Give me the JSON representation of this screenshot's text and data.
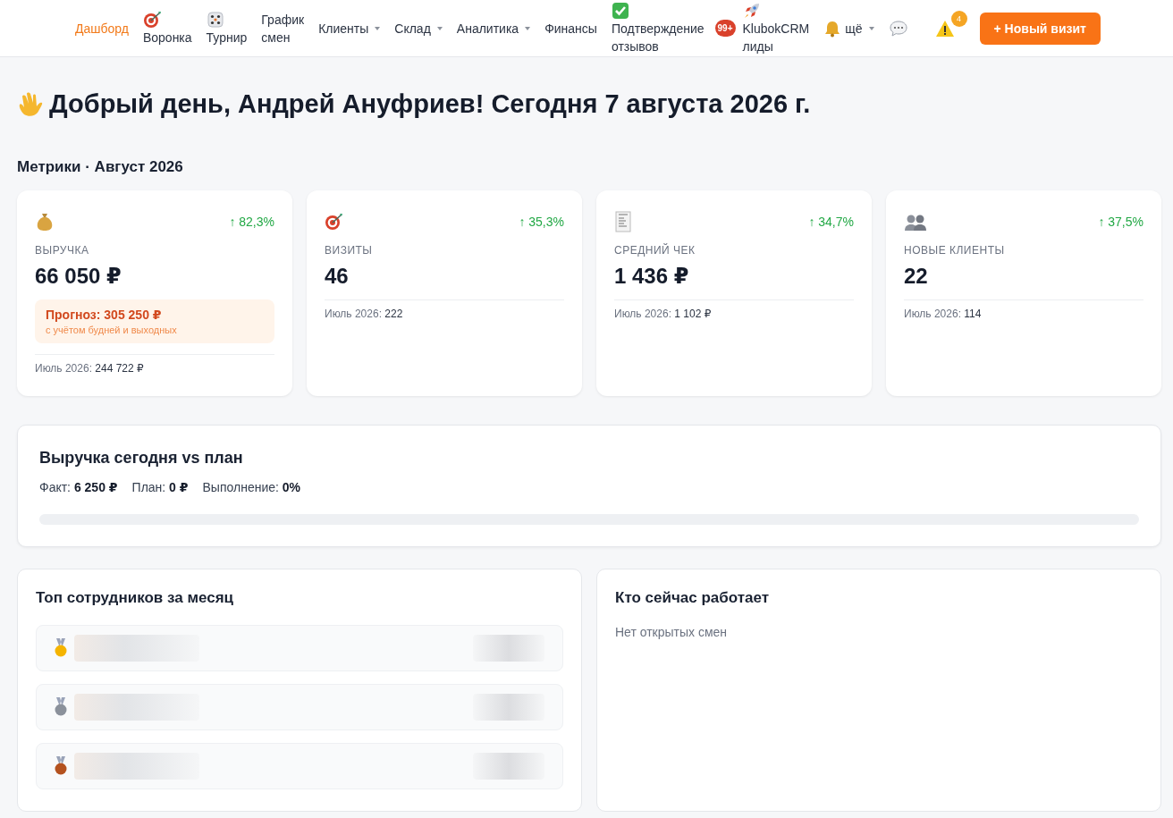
{
  "nav": {
    "items": [
      {
        "label": "Дашборд",
        "kind": "plain",
        "dropdown": false,
        "selected": true
      },
      {
        "label": "Воронка",
        "kind": "target",
        "dropdown": false,
        "selected": false
      },
      {
        "label": "Турнир",
        "kind": "dice",
        "dropdown": false,
        "selected": false
      },
      {
        "label": "График смен",
        "kind": "plain",
        "dropdown": false,
        "selected": false
      },
      {
        "label": "Клиенты",
        "kind": "plain",
        "dropdown": true,
        "selected": false
      },
      {
        "label": "Склад",
        "kind": "plain",
        "dropdown": true,
        "selected": false
      },
      {
        "label": "Аналитика",
        "kind": "plain",
        "dropdown": true,
        "selected": false
      },
      {
        "label": "Финансы",
        "kind": "plain",
        "dropdown": false,
        "selected": false
      },
      {
        "label": "Подтверждение отзывов",
        "kind": "check",
        "dropdown": false,
        "selected": false,
        "badge": "99+"
      },
      {
        "label": "KlubokCRM лиды",
        "kind": "rocket",
        "dropdown": false,
        "selected": false
      },
      {
        "label": "щё",
        "kind": "bell",
        "dropdown": true,
        "selected": false
      }
    ],
    "alerts_badge": "4",
    "new_visit_button": "+ Новый визит"
  },
  "greeting": "Добрый день, Андрей Ануфриев! Сегодня 7 августа 2026 г.",
  "metrics_title": "Метрики · Август 2026",
  "metrics": [
    {
      "kind": "money",
      "change": "↑ 82,3%",
      "label": "ВЫРУЧКА",
      "value": "66 050 ₽",
      "forecast": {
        "title": "Прогноз: 305 250 ₽",
        "note": "с учётом будней и выходных"
      },
      "prev_label": "Июль 2026:",
      "prev_value": "244 722 ₽"
    },
    {
      "kind": "target",
      "change": "↑ 35,3%",
      "label": "ВИЗИТЫ",
      "value": "46",
      "prev_label": "Июль 2026:",
      "prev_value": "222"
    },
    {
      "kind": "receipt",
      "change": "↑ 34,7%",
      "label": "СРЕДНИЙ ЧЕК",
      "value": "1 436 ₽",
      "prev_label": "Июль 2026:",
      "prev_value": "1 102 ₽"
    },
    {
      "kind": "people",
      "change": "↑ 37,5%",
      "label": "НОВЫЕ КЛИЕНТЫ",
      "value": "22",
      "prev_label": "Июль 2026:",
      "prev_value": "114"
    }
  ],
  "plan": {
    "title": "Выручка сегодня vs план",
    "stats": [
      {
        "label": "Факт:",
        "value": "6 250 ₽"
      },
      {
        "label": "План:",
        "value": "0 ₽"
      },
      {
        "label": "Выполнение:",
        "value": "0%"
      }
    ],
    "level": 0
  },
  "top_staff": {
    "title": "Топ сотрудников за месяц",
    "rows": [
      {
        "kind": "gold"
      },
      {
        "kind": "silver"
      },
      {
        "kind": "bronze"
      }
    ]
  },
  "on_shift": {
    "title": "Кто сейчас работает",
    "empty": "Нет открытых смен"
  }
}
